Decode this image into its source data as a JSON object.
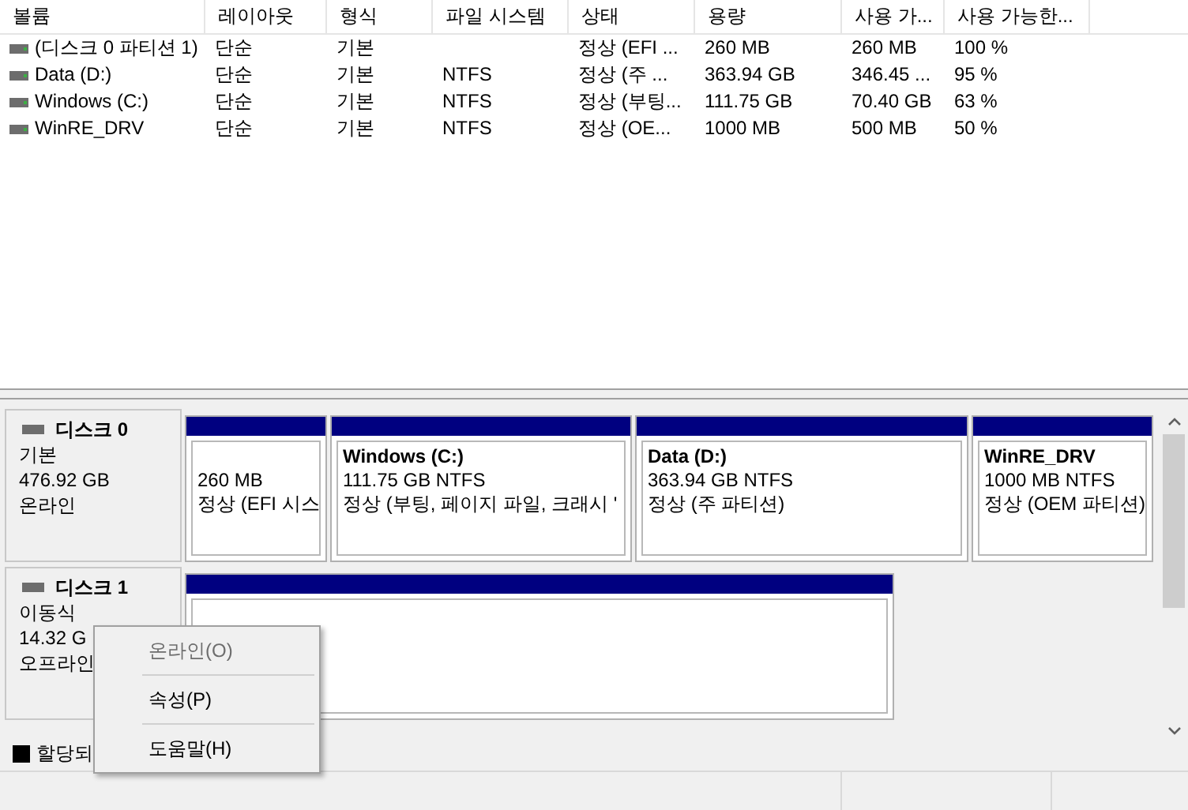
{
  "volume_table": {
    "columns": [
      "볼륨",
      "레이아웃",
      "형식",
      "파일 시스템",
      "상태",
      "용량",
      "사용 가...",
      "사용 가능한..."
    ],
    "rows": [
      {
        "cells": [
          "(디스크 0 파티션 1)",
          "단순",
          "기본",
          "",
          "정상 (EFI ...",
          "260 MB",
          "260 MB",
          "100 %"
        ]
      },
      {
        "cells": [
          "Data (D:)",
          "단순",
          "기본",
          "NTFS",
          "정상 (주 ...",
          "363.94 GB",
          "346.45 ...",
          "95 %"
        ]
      },
      {
        "cells": [
          "Windows (C:)",
          "단순",
          "기본",
          "NTFS",
          "정상 (부팅...",
          "111.75 GB",
          "70.40 GB",
          "63 %"
        ]
      },
      {
        "cells": [
          "WinRE_DRV",
          "단순",
          "기본",
          "NTFS",
          "정상 (OE...",
          "1000 MB",
          "500 MB",
          "50 %"
        ]
      }
    ]
  },
  "disks": [
    {
      "name": "디스크 0",
      "type": "기본",
      "size": "476.92 GB",
      "status": "온라인",
      "partitions": [
        {
          "kind": "primary",
          "size": "260 MB",
          "state": "정상 (EFI 시스"
        },
        {
          "kind": "primary",
          "name": "Windows  (C:)",
          "size": "111.75 GB NTFS",
          "state": "정상 (부팅, 페이지 파일, 크래시 '"
        },
        {
          "kind": "primary",
          "name": "Data  (D:)",
          "size": "363.94 GB NTFS",
          "state": "정상 (주 파티션)"
        },
        {
          "kind": "primary",
          "name": "WinRE_DRV",
          "size": "1000 MB NTFS",
          "state": "정상 (OEM 파티션)"
        }
      ]
    },
    {
      "name": "디스크 1",
      "type": "이동식",
      "size": "14.32 G",
      "status": "오프라인",
      "partitions": [
        {
          "kind": "primary"
        }
      ]
    }
  ],
  "legend": [
    {
      "label": "할당되",
      "color": "#000000"
    }
  ],
  "context_menu": {
    "items": [
      {
        "label": "온라인(O)",
        "disabled": true
      },
      {
        "label": "속성(P)",
        "disabled": false
      },
      {
        "label": "도움말(H)",
        "disabled": false
      }
    ]
  }
}
